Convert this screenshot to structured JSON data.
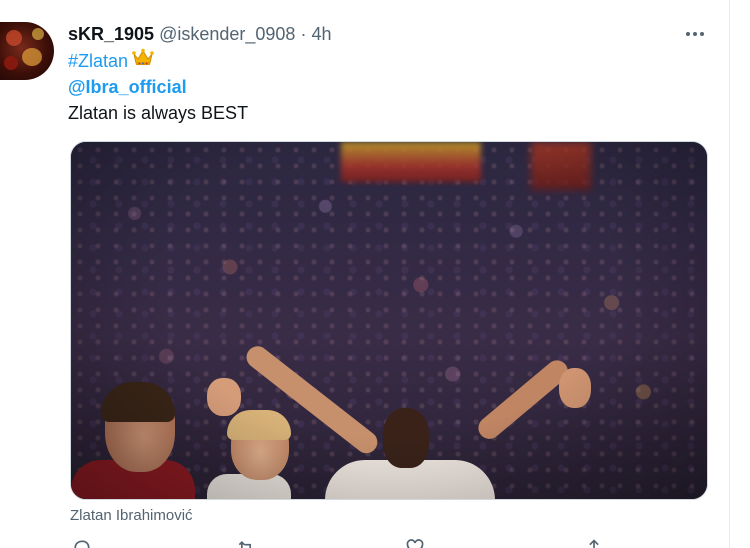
{
  "tweet": {
    "display_name": "sKR_1905",
    "handle": "@iskender_0908",
    "separator": "·",
    "time": "4h",
    "hashtag": "#Zlatan",
    "hashtag_emoji": "crown-icon",
    "mention": "@Ibra_official",
    "text": "Zlatan is always BEST",
    "media_caption": "Zlatan Ibrahimović"
  },
  "actions": [
    {
      "name": "reply-button",
      "icon": "reply-icon"
    },
    {
      "name": "retweet-button",
      "icon": "retweet-icon"
    },
    {
      "name": "like-button",
      "icon": "heart-icon"
    },
    {
      "name": "share-button",
      "icon": "share-icon"
    }
  ],
  "colors": {
    "link": "#1d9bf0",
    "secondary_text": "#536471",
    "primary_text": "#0f1419",
    "border": "#cfd9de"
  }
}
